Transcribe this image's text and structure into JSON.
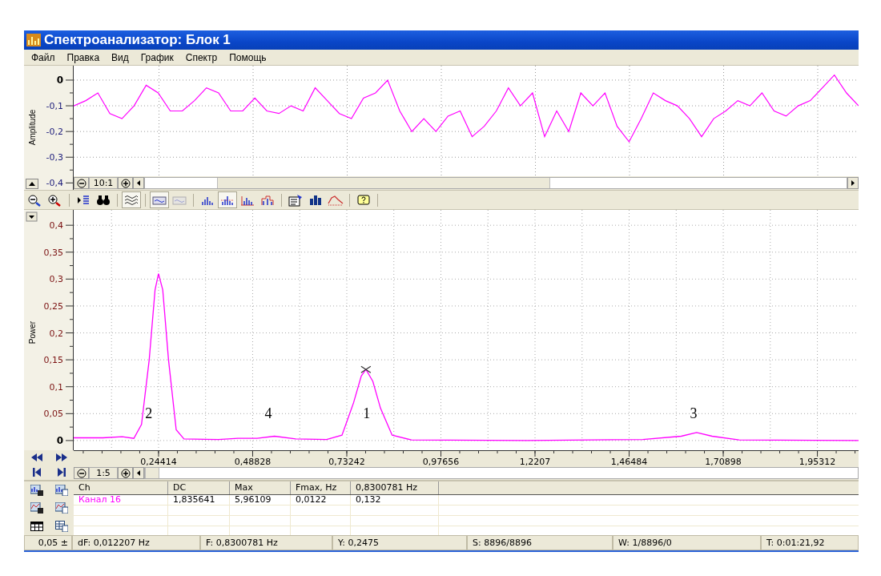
{
  "window": {
    "title": "Спектроанализатор: Блок 1"
  },
  "menu": [
    "Файл",
    "Правка",
    "Вид",
    "График",
    "Спектр",
    "Помощь"
  ],
  "waveform": {
    "zoom": "10:1",
    "chart_data": {
      "type": "line",
      "ylabel": "Amplitude",
      "ylim": [
        -0.427,
        0.056
      ],
      "grid": true,
      "yticks": [
        {
          "value": 0,
          "label": "0"
        },
        {
          "value": -0.1,
          "label": "-0,1"
        },
        {
          "value": -0.2,
          "label": "-0,2"
        },
        {
          "value": -0.3,
          "label": "-0,3"
        },
        {
          "value": -0.4,
          "label": "-0,4"
        }
      ],
      "series": [
        {
          "color": "#ff00ff",
          "values": [
            -0.1,
            -0.08,
            -0.05,
            -0.13,
            -0.15,
            -0.1,
            -0.02,
            -0.05,
            -0.12,
            -0.12,
            -0.08,
            -0.03,
            -0.05,
            -0.12,
            -0.12,
            -0.07,
            -0.12,
            -0.13,
            -0.1,
            -0.12,
            -0.03,
            -0.08,
            -0.13,
            -0.15,
            -0.07,
            -0.05,
            0.0,
            -0.12,
            -0.2,
            -0.15,
            -0.2,
            -0.14,
            -0.12,
            -0.22,
            -0.18,
            -0.12,
            -0.03,
            -0.1,
            -0.05,
            -0.22,
            -0.12,
            -0.2,
            -0.05,
            -0.1,
            -0.05,
            -0.18,
            -0.24,
            -0.15,
            -0.05,
            -0.08,
            -0.1,
            -0.15,
            -0.22,
            -0.15,
            -0.12,
            -0.08,
            -0.1,
            -0.05,
            -0.12,
            -0.14,
            -0.1,
            -0.08,
            -0.03,
            0.02,
            -0.05,
            -0.1
          ]
        }
      ]
    }
  },
  "toolbar": [
    [
      {
        "kind": "zoom-out",
        "selected": false
      },
      {
        "kind": "zoom-in",
        "selected": false
      }
    ],
    [
      {
        "kind": "marker-list",
        "selected": false
      },
      {
        "kind": "binoculars",
        "selected": false
      }
    ],
    [
      {
        "kind": "wave",
        "selected": true
      }
    ],
    [
      {
        "kind": "window",
        "selected": true
      },
      {
        "kind": "window",
        "selected": false,
        "disabled": true
      }
    ],
    [
      {
        "kind": "bars",
        "selected": false
      },
      {
        "kind": "bars-grid",
        "selected": true
      },
      {
        "kind": "bars-axis",
        "selected": false
      },
      {
        "kind": "bars-step",
        "selected": false
      }
    ],
    [
      {
        "kind": "properties",
        "selected": false
      },
      {
        "kind": "bar-chart",
        "selected": false
      },
      {
        "kind": "envelope",
        "selected": false
      }
    ],
    [
      {
        "kind": "help",
        "selected": false
      }
    ]
  ],
  "spectrum": {
    "zoom": "1:5",
    "chart_data": {
      "type": "line",
      "ylabel": "Power",
      "xlim": [
        0.024,
        2.06
      ],
      "ylim": [
        -0.018,
        0.43
      ],
      "x": [
        0.024,
        0.1,
        0.15,
        0.18,
        0.2,
        0.22,
        0.235,
        0.244,
        0.255,
        0.27,
        0.29,
        0.31,
        0.4,
        0.45,
        0.5,
        0.545,
        0.6,
        0.68,
        0.72,
        0.75,
        0.77,
        0.782,
        0.8,
        0.82,
        0.85,
        0.9,
        1.2,
        1.5,
        1.6,
        1.64,
        1.68,
        1.75,
        2.06
      ],
      "grid": true,
      "series": [
        {
          "color": "#ff00ff",
          "values": [
            0.005,
            0.005,
            0.007,
            0.004,
            0.03,
            0.15,
            0.28,
            0.31,
            0.28,
            0.15,
            0.02,
            0.003,
            0.002,
            0.004,
            0.004,
            0.008,
            0.003,
            0.002,
            0.01,
            0.07,
            0.12,
            0.132,
            0.11,
            0.06,
            0.01,
            0.001,
            0,
            0.002,
            0.008,
            0.015,
            0.008,
            0.001,
            0
          ]
        }
      ],
      "xticks": [
        {
          "value": 0.24414,
          "label": "0,24414"
        },
        {
          "value": 0.48828,
          "label": "0,48828"
        },
        {
          "value": 0.73242,
          "label": "0,73242"
        },
        {
          "value": 0.97656,
          "label": "0,97656"
        },
        {
          "value": 1.2207,
          "label": "1,2207"
        },
        {
          "value": 1.46484,
          "label": "1,46484"
        },
        {
          "value": 1.70898,
          "label": "1,70898"
        },
        {
          "value": 1.95312,
          "label": "1,95312"
        }
      ],
      "yticks": [
        {
          "value": 0,
          "label": "0"
        },
        {
          "value": 0.05,
          "label": "0,05"
        },
        {
          "value": 0.1,
          "label": "0,1"
        },
        {
          "value": 0.15,
          "label": "0,15"
        },
        {
          "value": 0.2,
          "label": "0,2"
        },
        {
          "value": 0.25,
          "label": "0,25"
        },
        {
          "value": 0.3,
          "label": "0,3"
        },
        {
          "value": 0.35,
          "label": "0,35"
        },
        {
          "value": 0.4,
          "label": "0,4"
        }
      ],
      "annotations": [
        "2",
        "4",
        "1",
        "3"
      ]
    }
  },
  "table": {
    "columns": [
      "Ch",
      "DC",
      "Max",
      "Fmax, Hz",
      "0,8300781 Hz"
    ],
    "rows": [
      {
        "cells": [
          "Канал 16",
          "1,835641",
          "5,96109",
          "0,0122",
          "0,132"
        ],
        "color": "#ff00ff"
      }
    ]
  },
  "status_bar": [
    "0,05 ±",
    "dF: 0,012207 Hz",
    "F: 0,8300781 Hz",
    "Y: 0,2475",
    "S: 8896/8896",
    "W: 1/8896/0",
    "T: 0:01:21,92"
  ]
}
